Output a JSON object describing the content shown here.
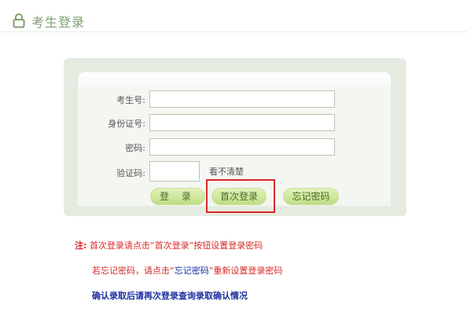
{
  "header": {
    "icon": "lock-icon",
    "title": "考生登录",
    "accent_color": "#7fa070"
  },
  "form": {
    "fields": [
      {
        "label": "考生号:",
        "value": ""
      },
      {
        "label": "身份证号:",
        "value": ""
      },
      {
        "label": "密码:",
        "value": ""
      },
      {
        "label": "验证码:",
        "value": ""
      }
    ],
    "captcha_link": "看不清楚",
    "buttons": {
      "login": "登 录",
      "first_login": "首次登录",
      "forgot_password": "忘记密码"
    },
    "highlight_color": "#d62a2a"
  },
  "notes": {
    "line1": {
      "prefix": "注:",
      "text": "首次登录请点击“首次登录”按钮设置登录密码"
    },
    "line2": {
      "before": "若忘记密码，请点击“",
      "link": "忘记密码",
      "after": "”重新设置登录密码"
    },
    "line3": "确认录取后请再次登录查询录取确认情况"
  }
}
